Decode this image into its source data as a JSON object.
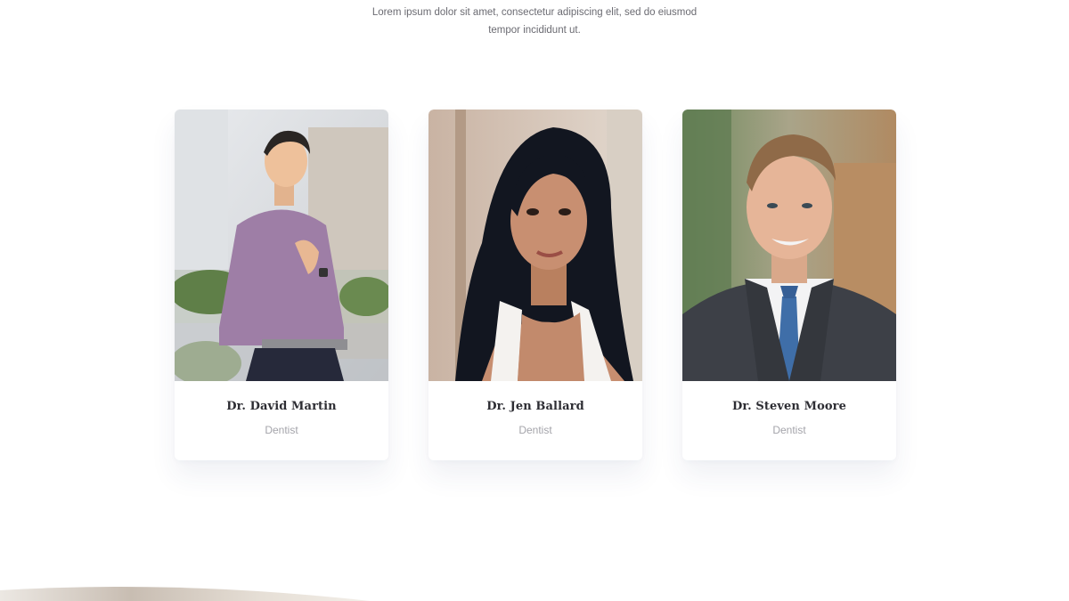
{
  "intro": {
    "line1": "Lorem ipsum dolor sit amet, consectetur adipiscing elit, sed do eiusmod",
    "line2": "tempor incididunt ut."
  },
  "team": [
    {
      "name": "Dr. David Martin",
      "role": "Dentist"
    },
    {
      "name": "Dr. Jen Ballard",
      "role": "Dentist"
    },
    {
      "name": "Dr. Steven Moore",
      "role": "Dentist"
    }
  ]
}
